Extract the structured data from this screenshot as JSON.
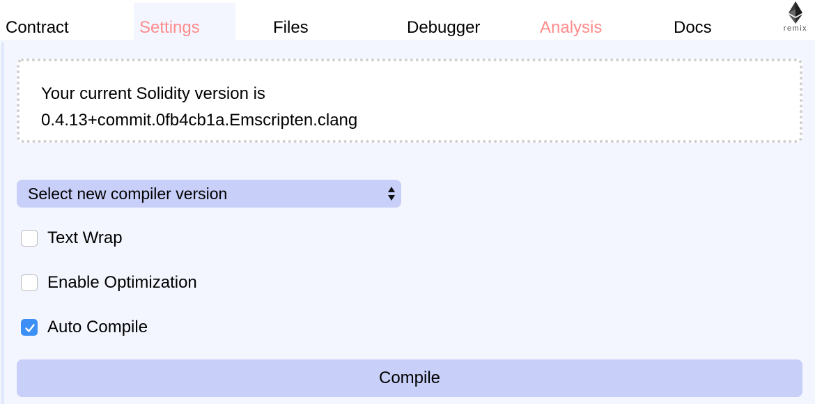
{
  "tabs": [
    {
      "label": "Contract",
      "active": false,
      "color": "#000000"
    },
    {
      "label": "Settings",
      "active": true,
      "color": "#ff8b8b"
    },
    {
      "label": "Files",
      "active": false,
      "color": "#000000"
    },
    {
      "label": "Debugger",
      "active": false,
      "color": "#000000"
    },
    {
      "label": "Analysis",
      "active": false,
      "color": "#ff8b8b"
    },
    {
      "label": "Docs",
      "active": false,
      "color": "#000000"
    }
  ],
  "logo": {
    "icon": "ethereum-logo-icon",
    "text": "remix"
  },
  "settings": {
    "version_line1": "Your current Solidity version is",
    "version_line2": "0.4.13+commit.0fb4cb1a.Emscripten.clang",
    "compiler_select": {
      "selected": "Select new compiler version",
      "icon": "select-arrows-icon"
    },
    "options": [
      {
        "label": "Text Wrap",
        "checked": false
      },
      {
        "label": "Enable Optimization",
        "checked": false
      },
      {
        "label": "Auto Compile",
        "checked": true
      }
    ],
    "compile_label": "Compile"
  },
  "colors": {
    "accent_red": "#ff8b8b",
    "panel_bg": "#f4f6ff",
    "button_bg": "#c8cff8",
    "checkbox_checked": "#3c8ff5"
  }
}
